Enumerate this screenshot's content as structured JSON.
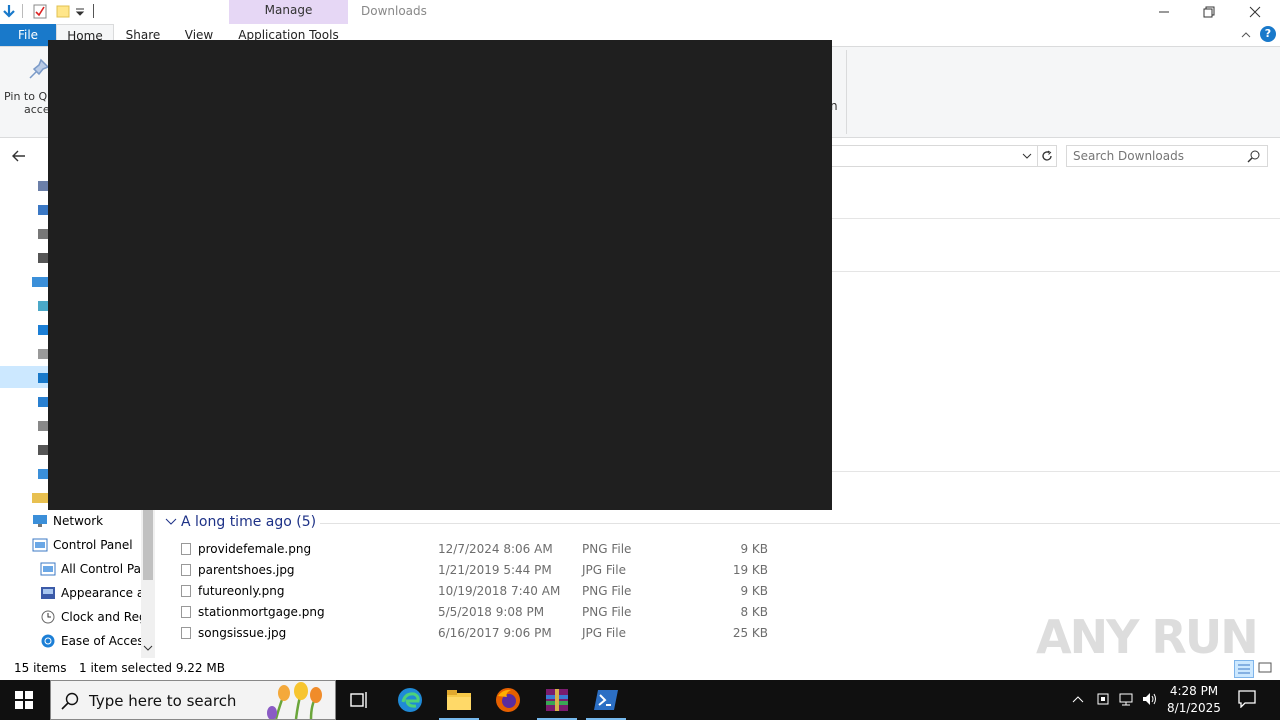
{
  "window": {
    "title": "Downloads",
    "context_tab_group": "Manage"
  },
  "ribbon": {
    "file_tab": "File",
    "tabs": [
      "Home",
      "Share",
      "View",
      "Application Tools"
    ],
    "pin_label_line1": "Pin to Q",
    "pin_label_line2": "acce",
    "partial_right_label": "n"
  },
  "address": {
    "search_placeholder": "Search Downloads"
  },
  "nav": {
    "items": [
      {
        "label": "Network",
        "icon": "network-icon"
      },
      {
        "label": "Control Panel",
        "icon": "control-panel-icon"
      },
      {
        "label": "All Control Par",
        "icon": "control-panel-icon"
      },
      {
        "label": "Appearance an",
        "icon": "appearance-icon"
      },
      {
        "label": "Clock and Regi",
        "icon": "clock-icon"
      },
      {
        "label": "Ease of Access",
        "icon": "ease-of-access-icon"
      }
    ]
  },
  "content": {
    "group_header": "A long time ago (5)",
    "files": [
      {
        "name": "providefemale.png",
        "date": "12/7/2024 8:06 AM",
        "type": "PNG File",
        "size": "9 KB"
      },
      {
        "name": "parentshoes.jpg",
        "date": "1/21/2019 5:44 PM",
        "type": "JPG File",
        "size": "19 KB"
      },
      {
        "name": "futureonly.png",
        "date": "10/19/2018 7:40 AM",
        "type": "PNG File",
        "size": "9 KB"
      },
      {
        "name": "stationmortgage.png",
        "date": "5/5/2018 9:08 PM",
        "type": "PNG File",
        "size": "8 KB"
      },
      {
        "name": "songsissue.jpg",
        "date": "6/16/2017 9:06 PM",
        "type": "JPG File",
        "size": "25 KB"
      }
    ]
  },
  "status": {
    "count": "15 items",
    "selected": "1 item selected  9.22 MB"
  },
  "watermark": "ANY RUN",
  "taskbar": {
    "search_placeholder": "Type here to search",
    "time": "4:28 PM",
    "date": "8/1/2025"
  },
  "colors": {
    "file_tab": "#1979ca",
    "manage_band": "#e6d7f5",
    "group_header": "#1e3287",
    "taskbar": "#101010",
    "overlay": "#1f1f1f"
  }
}
